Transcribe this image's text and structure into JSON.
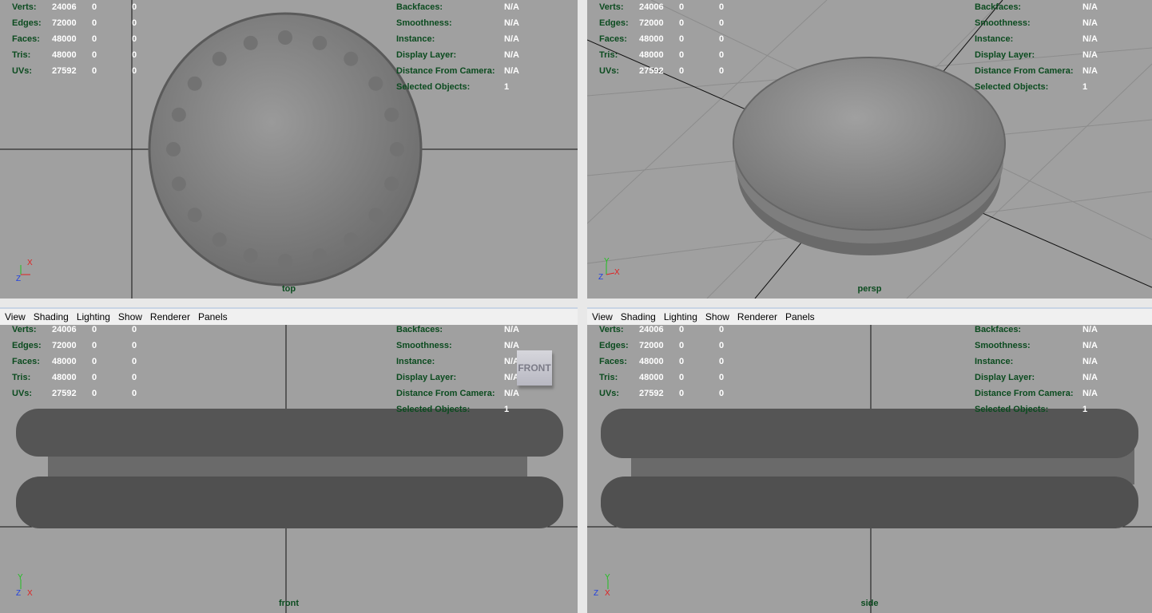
{
  "stats": {
    "labels": [
      "Verts:",
      "Edges:",
      "Faces:",
      "Tris:",
      "UVs:"
    ],
    "rows": [
      [
        "24006",
        "0",
        "0"
      ],
      [
        "72000",
        "0",
        "0"
      ],
      [
        "48000",
        "0",
        "0"
      ],
      [
        "48000",
        "0",
        "0"
      ],
      [
        "27592",
        "0",
        "0"
      ]
    ]
  },
  "info": {
    "labels": [
      "Backfaces:",
      "Smoothness:",
      "Instance:",
      "Display Layer:",
      "Distance From Camera:",
      "Selected Objects:"
    ],
    "values": [
      "N/A",
      "N/A",
      "N/A",
      "N/A",
      "N/A",
      "1"
    ]
  },
  "menu": [
    "View",
    "Shading",
    "Lighting",
    "Show",
    "Renderer",
    "Panels"
  ],
  "viewports": {
    "top": "top",
    "persp": "persp",
    "front": "front",
    "side": "side"
  },
  "viewcube": "FRONT",
  "axes": {
    "x": "X",
    "y": "Y",
    "z": "Z"
  },
  "colors": {
    "viewport_bg": "#a0a0a0",
    "hud_label": "#0b4b1f",
    "x_axis": "#e02020",
    "y_axis": "#20c020",
    "z_axis": "#2040e0"
  }
}
